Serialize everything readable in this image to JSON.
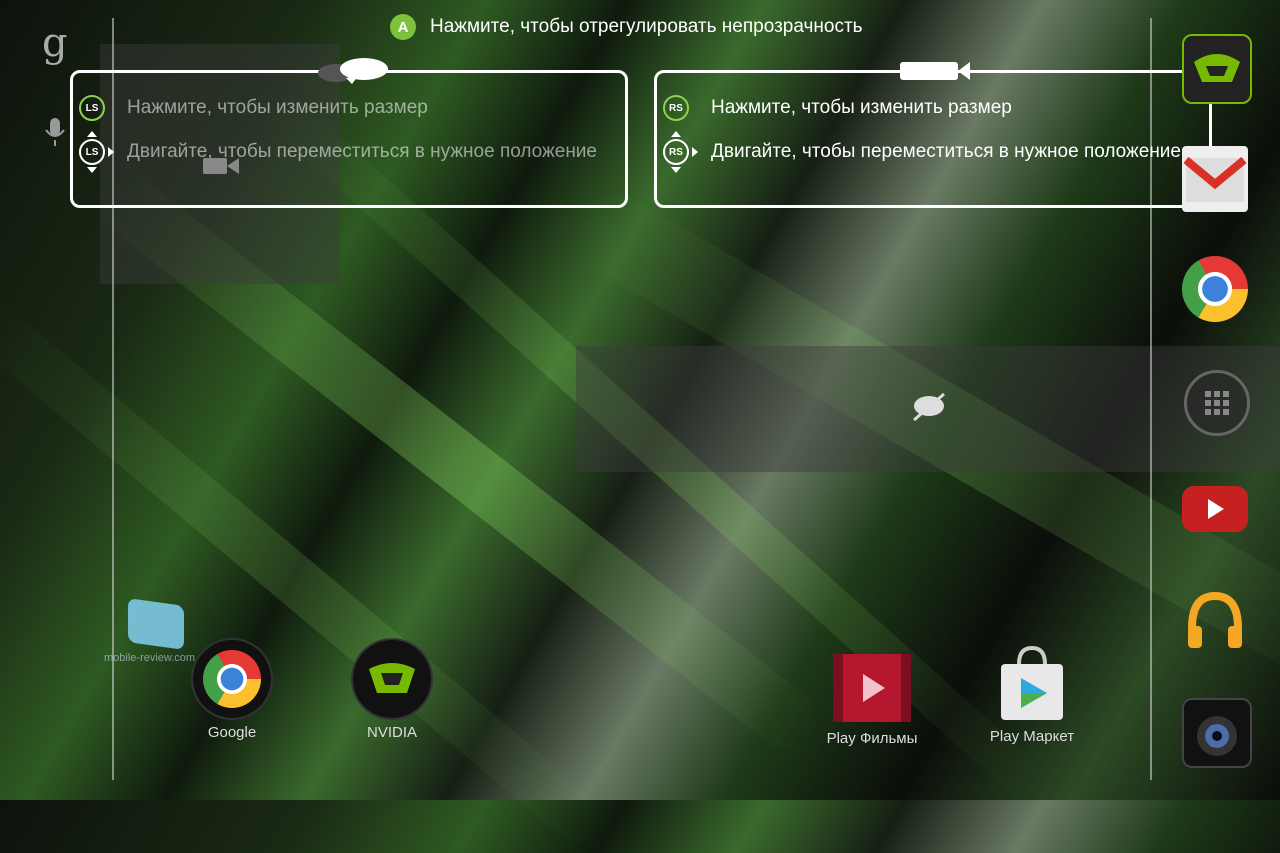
{
  "top_hint": {
    "button": "A",
    "text": "Нажмите, чтобы отрегулировать непрозрачность"
  },
  "left_panel": {
    "icon": "speech-bubble-icon",
    "resize_stick": "LS",
    "resize_text": "Нажмите, чтобы изменить размер",
    "move_stick": "LS",
    "move_text": "Двигайте, чтобы переместиться в нужное положение"
  },
  "right_panel": {
    "icon": "video-camera-icon",
    "resize_stick": "RS",
    "resize_text": "Нажмите, чтобы изменить размер",
    "move_stick": "RS",
    "move_text": "Двигайте, чтобы переместиться в нужное положение"
  },
  "left_sidebar": {
    "google_letter": "g"
  },
  "desktop_apps": [
    {
      "label": "Google"
    },
    {
      "label": "NVIDIA"
    },
    {
      "label": "Play Фильмы"
    },
    {
      "label": "Play Маркет"
    }
  ],
  "watermark": "mobile-review.com",
  "colors": {
    "accent_green": "#7dc23b",
    "nvidia_green": "#76b900",
    "youtube_red": "#cc2222",
    "gmail_red": "#d93025"
  }
}
